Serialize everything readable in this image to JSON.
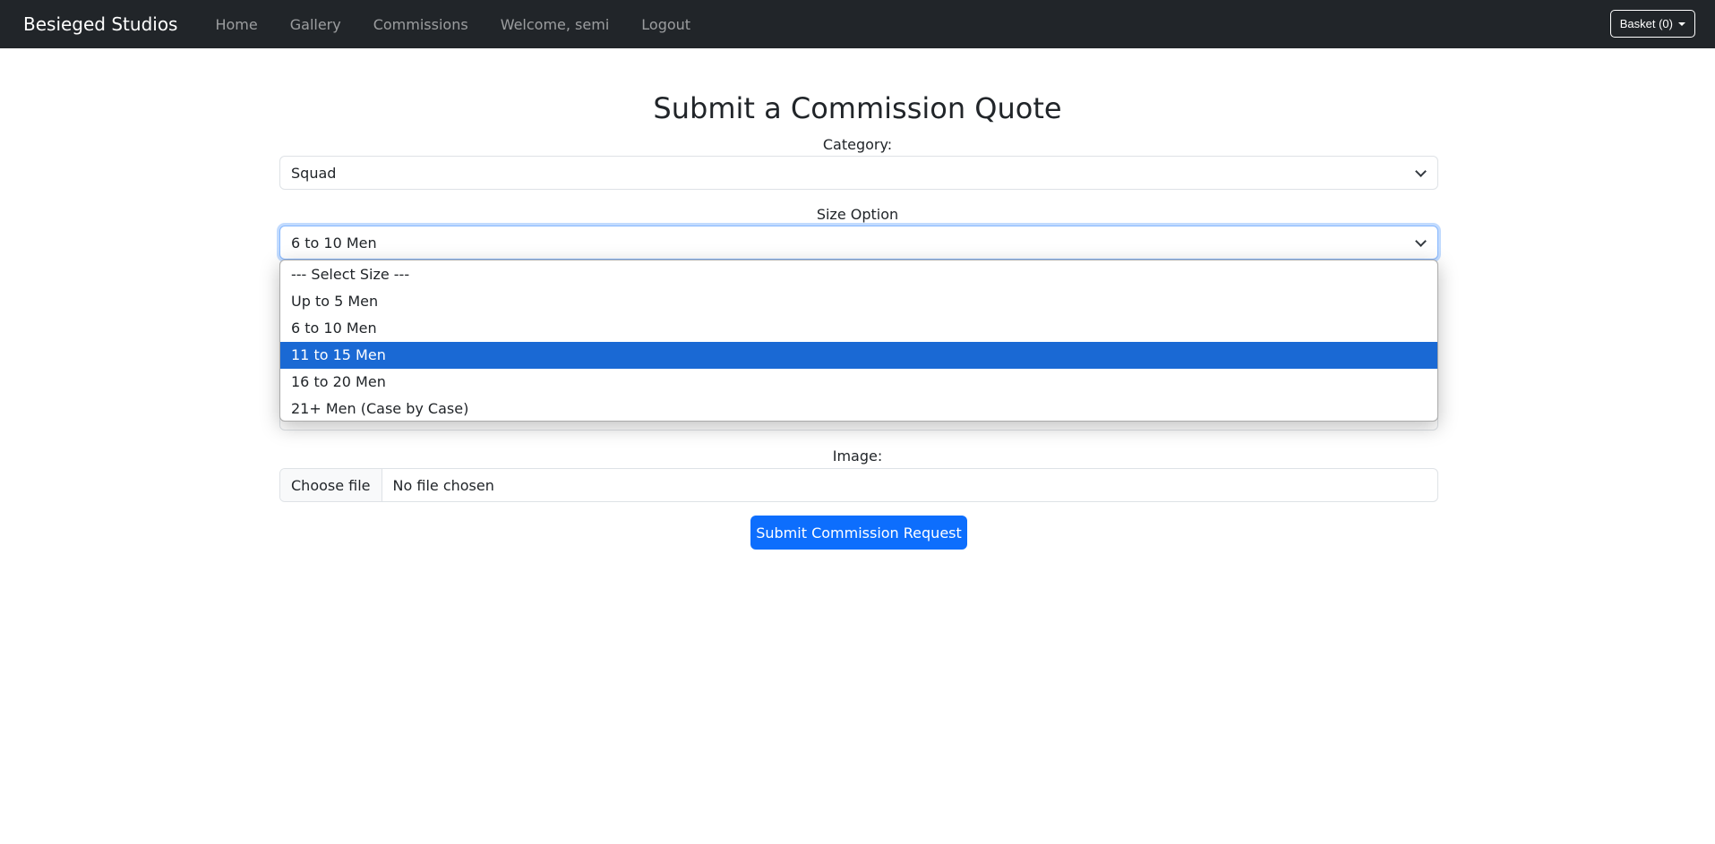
{
  "navbar": {
    "brand": "Besieged Studios",
    "links": [
      "Home",
      "Gallery",
      "Commissions",
      "Welcome, semi",
      "Logout"
    ],
    "basket": "Basket (0)"
  },
  "form": {
    "title": "Submit a Commission Quote",
    "category_label": "Category:",
    "category_value": "Squad",
    "size_label": "Size Option",
    "size_value": "6 to 10 Men",
    "size_options": [
      "--- Select Size ---",
      "Up to 5 Men",
      "6 to 10 Men",
      "11 to 15 Men",
      "16 to 20 Men",
      "21+ Men (Case by Case)"
    ],
    "highlighted_option": "11 to 15 Men",
    "image_label": "Image:",
    "choose_file": "Choose file",
    "no_file": "No file chosen",
    "submit": "Submit Commission Request"
  },
  "colors": {
    "navbar": "#212529",
    "primary": "#0d6efd",
    "highlight": "#1a69d4"
  }
}
